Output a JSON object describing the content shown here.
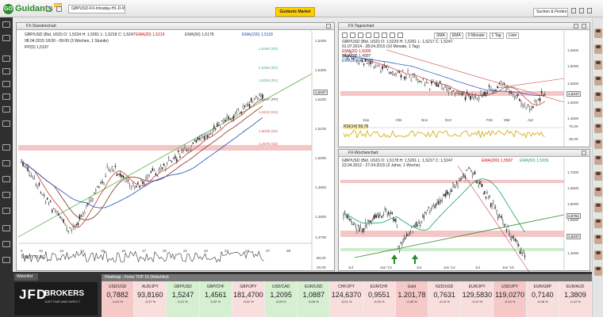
{
  "topbar": {
    "dropdown": "GBPUSD-FX-Intraday-H1-D-W",
    "markets_button": "Guidants Market",
    "search": "Suchen & Finden"
  },
  "colors": {
    "green": "#2b8a2b",
    "accent": "#ffd000",
    "red_zone": "#f4c6c6",
    "green_zone": "#cfeccf"
  },
  "panel_left": {
    "title": "FX-Stundenchart",
    "legend1": "GBP/USD (Bid, USD) O: 1,5234 H: 1,5261 L: 1,5218 C: 1,5247",
    "ema20": "EMA(20) 1,5219",
    "ema50": "EMA(50) 1,5178",
    "ema100": "EMA(100) 1,5118",
    "legend2": "08.04.2015 18:00 - 09:00 (3 Wochen, 1 Stunde)",
    "legend3": "PP(D) 1,5197",
    "price_tag": "1,5247",
    "y_labels": [
      "1,5400",
      "1,5300",
      "1,5200",
      "1,5100",
      "1,5000",
      "1,4900",
      "1,4800",
      "1,4700"
    ],
    "pivots": [
      "1,5450 (R3)",
      "1,5350 (R2)",
      "1,5292 (R1)",
      "1,5197 (PP)",
      "1,5134 (S1)",
      "1,5039 (S2)",
      "1,4976 (S3)"
    ],
    "x_labels": [
      "9",
      "10",
      "13",
      "14",
      "15",
      "16",
      "17",
      "20",
      "21",
      "22",
      "23",
      "24",
      "27",
      "28"
    ],
    "rsi_label": "RSI(7) 73,01",
    "rsi_levels": [
      "80,00",
      "20,00"
    ]
  },
  "panel_daily": {
    "title": "FX-Tageschart",
    "toolbar": [
      "SMA",
      "EMA",
      "0 Monate",
      "1 Tag",
      "Linie"
    ],
    "legend1": "GBP/USD (Bid, USD) O: 1,5229 H: 1,5261 L: 1,5217 C: 1,5247",
    "legend2": "01.07.2014 - 28.04.2015 (10 Monate, 1 Tag)",
    "ema20": "EMA(20) 1,5000",
    "ema50": "EMA(50) 1,4997",
    "ema100": "EMA(100) 1,5145",
    "y_labels": [
      "1,6500",
      "1,6000",
      "1,5500",
      "1,5000",
      "1,4500"
    ],
    "price_tag": "1,5247",
    "x_labels": [
      "Sep",
      "Okt",
      "Nov",
      "Dez",
      "Feb",
      "Mär",
      "Apr"
    ],
    "rsi_label": "RSI(14) 59,78",
    "rsi_levels": [
      "70,00",
      "30,00"
    ]
  },
  "panel_weekly": {
    "title": "FX-Wochenchart",
    "legend1": "GBP/USD (Bid, USD) O: 1,5178 H: 1,5261 L: 1,5217 C: 1,5247",
    "ema200": "EMA(200) 1,5597",
    "ema50": "EMA(50) 1,5939",
    "legend2": "23.04.2012 - 27.04.2015 (3 Jahre, 1 Woche)",
    "y_labels": [
      "1,7000",
      "1,6500",
      "1,6000",
      "1,5500",
      "1,5000",
      "1,4500"
    ],
    "price_tag": "1,5247",
    "tag_2": "1,5751",
    "x_labels": [
      "Jul",
      "Jan '13",
      "Jul",
      "Jan '14",
      "Jul",
      "Jan '15"
    ]
  },
  "bottom": {
    "tab": "Watchlist",
    "heatmap_title": "Heatmap - Forex TOP 16 (Watchlist)",
    "brand": "JFD",
    "brand2": "BROKERS",
    "brand_tag": "JUST FAIR AND DIRECT",
    "quotes": [
      {
        "name": "USD/USD",
        "price": "0,7882",
        "chg": "-0,41 %"
      },
      {
        "name": "AUD/JPY",
        "price": "93,8160",
        "chg": "-0,37 %"
      },
      {
        "name": "GBP/USD",
        "price": "1,5247",
        "chg": "0,12 %"
      },
      {
        "name": "GBP/CHF",
        "price": "1,4561",
        "chg": "0,02 %"
      },
      {
        "name": "GBP/JPY",
        "price": "181,4700",
        "chg": "-0,01 %"
      },
      {
        "name": "USD/CAD",
        "price": "1,2095",
        "chg": "0,05 %"
      },
      {
        "name": "EUR/USD",
        "price": "1,0887",
        "chg": "0,08 %"
      },
      {
        "name": "CHF/JPY",
        "price": "124,6370",
        "chg": "-0,01 %"
      },
      {
        "name": "EUR/CHF",
        "price": "0,9551",
        "chg": "-0,03 %"
      },
      {
        "name": "Gold",
        "price": "1.201,78",
        "chg": "-0,05 %"
      },
      {
        "name": "NZD/USD",
        "price": "0,7631",
        "chg": "-0,13 %"
      },
      {
        "name": "EUR/JPY",
        "price": "129,5830",
        "chg": "-0,12 %"
      },
      {
        "name": "USD/JPY",
        "price": "119,0270",
        "chg": "-0,14 %"
      },
      {
        "name": "EUR/GBP",
        "price": "0,7140",
        "chg": "-0,08 %"
      },
      {
        "name": "EUR/AUD",
        "price": "1,3809",
        "chg": "-0,12 %"
      }
    ]
  }
}
